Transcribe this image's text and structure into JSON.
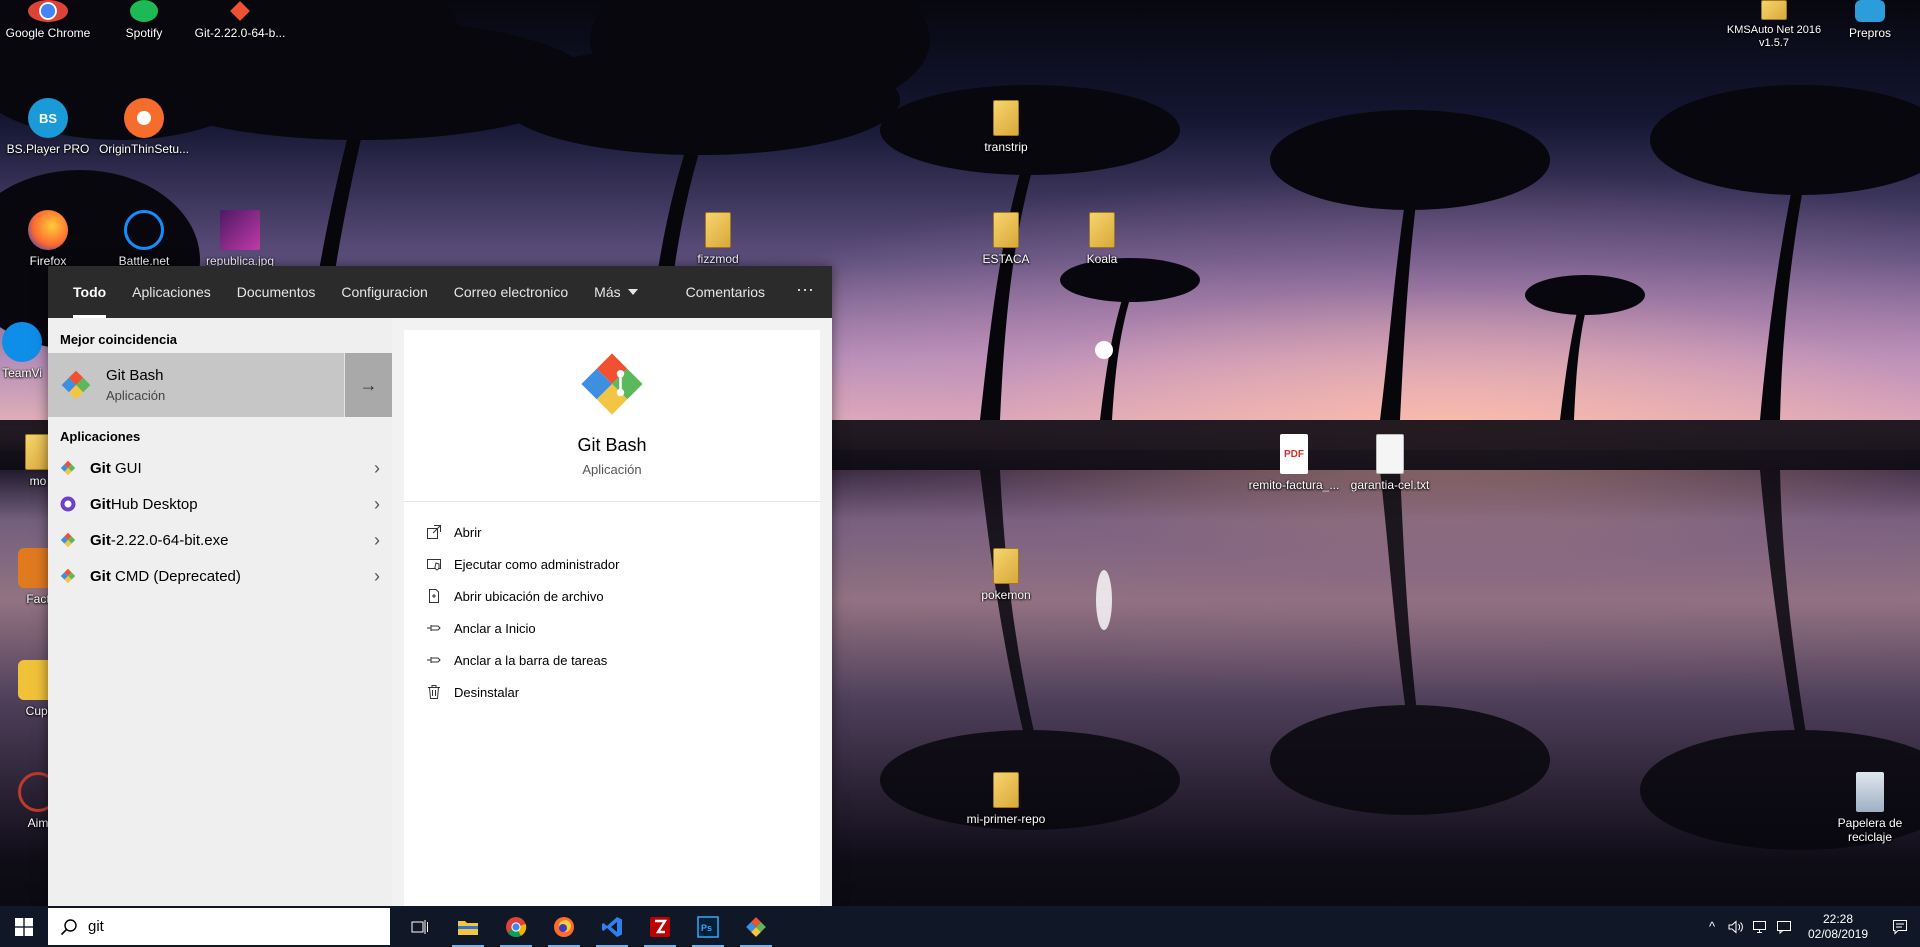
{
  "desktop": {
    "icons": [
      {
        "label": "Google Chrome",
        "icon": "chrome-icon"
      },
      {
        "label": "Spotify",
        "icon": "spotify-icon"
      },
      {
        "label": "Git-2.22.0-64-b...",
        "icon": "git-icon"
      },
      {
        "label": "BS.Player PRO",
        "icon": "bsplayer-icon"
      },
      {
        "label": "OriginThinSetu...",
        "icon": "origin-icon"
      },
      {
        "label": "Firefox",
        "icon": "firefox-icon"
      },
      {
        "label": "Battle.net",
        "icon": "battlenet-icon"
      },
      {
        "label": "republica.jpg",
        "icon": "image-icon"
      },
      {
        "label": "fizzmod",
        "icon": "folder-icon"
      },
      {
        "label": "transtrip",
        "icon": "folder-icon"
      },
      {
        "label": "ESTACA",
        "icon": "folder-icon"
      },
      {
        "label": "Koala",
        "icon": "folder-icon"
      },
      {
        "label": "remito-factura_...",
        "icon": "pdf-icon"
      },
      {
        "label": "garantia-cel.txt",
        "icon": "text-file-icon"
      },
      {
        "label": "pokemon",
        "icon": "folder-icon"
      },
      {
        "label": "mi-primer-repo",
        "icon": "folder-icon"
      },
      {
        "label": "KMSAuto Net 2016 v1.5.7",
        "icon": "folder-icon"
      },
      {
        "label": "Prepros",
        "icon": "prepros-icon"
      },
      {
        "label": "Papelera de reciclaje",
        "icon": "recycle-bin-icon"
      },
      {
        "label": "TeamVi",
        "icon": "teamviewer-icon"
      },
      {
        "label": "mo",
        "icon": "folder-icon"
      },
      {
        "label": "Fact",
        "icon": "app-icon"
      },
      {
        "label": "Cupl",
        "icon": "app-icon"
      },
      {
        "label": "Aim",
        "icon": "app-icon"
      }
    ]
  },
  "search": {
    "filters": {
      "todo": "Todo",
      "aplicaciones": "Aplicaciones",
      "documentos": "Documentos",
      "configuracion": "Configuracion",
      "correo": "Correo electronico",
      "mas": "Más",
      "comentarios": "Comentarios",
      "ellipsis": "···"
    },
    "best_match_header": "Mejor coincidencia",
    "best_match": {
      "title": "Git Bash",
      "subtitle": "Aplicación",
      "arrow": "→"
    },
    "apps_header": "Aplicaciones",
    "apps": [
      {
        "bold": "Git",
        "rest": " GUI",
        "icon": "git-icon"
      },
      {
        "bold": "Git",
        "rest": "Hub Desktop",
        "icon": "github-icon"
      },
      {
        "bold": "Git",
        "rest": "-2.22.0-64-bit.exe",
        "icon": "git-icon"
      },
      {
        "bold": "Git",
        "rest": " CMD (Deprecated)",
        "icon": "git-icon"
      }
    ],
    "chevron": "›",
    "detail": {
      "title": "Git Bash",
      "subtitle": "Aplicación",
      "actions": [
        {
          "label": "Abrir",
          "icon": "open-icon"
        },
        {
          "label": "Ejecutar como administrador",
          "icon": "admin-shield-icon"
        },
        {
          "label": "Abrir ubicación de archivo",
          "icon": "file-location-icon"
        },
        {
          "label": "Anclar a Inicio",
          "icon": "pin-icon"
        },
        {
          "label": "Anclar a la barra de tareas",
          "icon": "pin-icon"
        },
        {
          "label": "Desinstalar",
          "icon": "trash-icon"
        }
      ]
    }
  },
  "taskbar": {
    "search_value": "git",
    "apps": [
      "task-view-icon",
      "file-explorer-icon",
      "chrome-icon",
      "firefox-icon",
      "vscode-icon",
      "filezilla-icon",
      "photoshop-icon",
      "git-icon"
    ],
    "clock_time": "22:28",
    "clock_date": "02/08/2019",
    "tray_chevron": "^"
  },
  "colors": {
    "taskbar_bg": "#101727",
    "filter_bar_bg": "#2b2b2b",
    "best_match_bg": "#c6c6c6",
    "git_orange": "#f05133",
    "git_blue": "#3d8fe0",
    "git_green": "#5cb85c",
    "git_yellow": "#f4c542"
  }
}
